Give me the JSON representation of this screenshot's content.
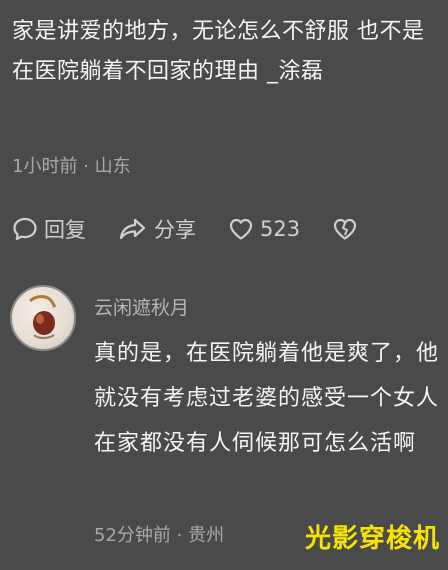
{
  "comment": {
    "text": "家是讲爱的地方，无论怎么不舒服  也不是在医院躺着不回家的理由   _涂磊",
    "meta": "1小时前 · 山东",
    "actions": {
      "reply_label": "回复",
      "share_label": "分享",
      "like_count": "523"
    }
  },
  "reply": {
    "username": "云闲遮秋月",
    "text": "真的是，在医院躺着他是爽了，他就没有考虑过老婆的感受一个女人在家都没有人伺候那可怎么活啊",
    "meta": "52分钟前 · 贵州"
  },
  "watermark": "光影穿梭机",
  "icons": [
    "reply-icon",
    "share-icon",
    "heart-icon",
    "dislike-heart-icon"
  ],
  "colors": {
    "background": "#4a4a4a",
    "text": "#f4f4f4",
    "meta": "#a8a8a8",
    "watermark": "#f5e400"
  }
}
